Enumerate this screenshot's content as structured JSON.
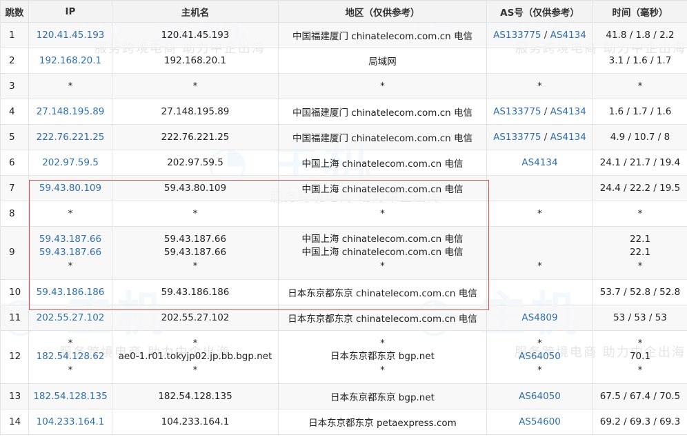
{
  "headers": [
    "跳数",
    "IP",
    "主机名",
    "地区（仅供参考）",
    "AS号（仅供参考）",
    "时间（毫秒）"
  ],
  "watermark": {
    "slogan": "服务跨境电商 助力中企出海"
  },
  "colors": {
    "link": "#2f6fad",
    "highlight_border": "#d9534f",
    "header_bg": "#f2f2f2",
    "border": "#e3e3e3"
  },
  "rows": [
    {
      "hop": "1",
      "ips": [
        "120.41.45.193"
      ],
      "hosts": [
        "120.41.45.193"
      ],
      "locs": [
        "中国福建厦门 chinatelecom.com.cn 电信"
      ],
      "as": [
        [
          "AS133775",
          "AS4134"
        ]
      ],
      "times": [
        "41.8 / 1.8 / 2.2"
      ]
    },
    {
      "hop": "2",
      "ips": [
        "192.168.20.1"
      ],
      "hosts": [
        "192.168.20.1"
      ],
      "locs": [
        "局域网"
      ],
      "as": [
        []
      ],
      "times": [
        "3.1 / 1.6 / 1.7"
      ]
    },
    {
      "hop": "3",
      "ips": [
        "*"
      ],
      "hosts": [
        "*"
      ],
      "locs": [
        "*"
      ],
      "as": [
        [
          "*"
        ]
      ],
      "times": [
        "*"
      ]
    },
    {
      "hop": "4",
      "ips": [
        "27.148.195.89"
      ],
      "hosts": [
        "27.148.195.89"
      ],
      "locs": [
        "中国福建厦门 chinatelecom.com.cn 电信"
      ],
      "as": [
        [
          "AS133775",
          "AS4134"
        ]
      ],
      "times": [
        "1.6 / 1.7 / 1.6"
      ]
    },
    {
      "hop": "5",
      "ips": [
        "222.76.221.25"
      ],
      "hosts": [
        "222.76.221.25"
      ],
      "locs": [
        "中国福建厦门 chinatelecom.com.cn 电信"
      ],
      "as": [
        [
          "AS133775",
          "AS4134"
        ]
      ],
      "times": [
        "4.9 / 10.7 / 8"
      ]
    },
    {
      "hop": "6",
      "ips": [
        "202.97.59.5"
      ],
      "hosts": [
        "202.97.59.5"
      ],
      "locs": [
        "中国上海 chinatelecom.com.cn 电信"
      ],
      "as": [
        [
          "AS4134"
        ]
      ],
      "times": [
        "24.1 / 21.7 / 19.4"
      ]
    },
    {
      "hop": "7",
      "ips": [
        "59.43.80.109"
      ],
      "hosts": [
        "59.43.80.109"
      ],
      "locs": [
        "中国上海 chinatelecom.com.cn 电信"
      ],
      "as": [
        []
      ],
      "times": [
        "24.4 / 22.2 / 19.5"
      ]
    },
    {
      "hop": "8",
      "ips": [
        "*"
      ],
      "hosts": [
        "*"
      ],
      "locs": [
        "*"
      ],
      "as": [
        [
          "*"
        ]
      ],
      "times": [
        "*"
      ]
    },
    {
      "hop": "9",
      "ips": [
        "59.43.187.66",
        "59.43.187.66",
        "*"
      ],
      "hosts": [
        "59.43.187.66",
        "59.43.187.66",
        "*"
      ],
      "locs": [
        "中国上海 chinatelecom.com.cn 电信",
        "中国上海 chinatelecom.com.cn 电信",
        "*"
      ],
      "as": [
        [],
        [],
        [
          "*"
        ]
      ],
      "times": [
        "22.1",
        "22.1",
        "*"
      ]
    },
    {
      "hop": "10",
      "ips": [
        "59.43.186.186"
      ],
      "hosts": [
        "59.43.186.186"
      ],
      "locs": [
        "日本东京都东京 chinatelecom.com.cn 电信"
      ],
      "as": [
        []
      ],
      "times": [
        "53.7 / 52.8 / 52.8"
      ]
    },
    {
      "hop": "11",
      "ips": [
        "202.55.27.102"
      ],
      "hosts": [
        "202.55.27.102"
      ],
      "locs": [
        "日本东京都东京 chinatelecom.com.cn 电信"
      ],
      "as": [
        [
          "AS4809"
        ]
      ],
      "times": [
        "53 / 53 / 53"
      ]
    },
    {
      "hop": "12",
      "ips": [
        "*",
        "182.54.128.62",
        "*"
      ],
      "hosts": [
        "*",
        "ae0-1.r01.tokyjp02.jp.bb.bgp.net",
        "*"
      ],
      "locs": [
        "*",
        "日本东京都东京 bgp.net",
        "*"
      ],
      "as": [
        [
          "*"
        ],
        [
          "AS64050"
        ],
        [
          "*"
        ]
      ],
      "times": [
        "*",
        "70.1",
        "*"
      ]
    },
    {
      "hop": "13",
      "ips": [
        "182.54.128.135"
      ],
      "hosts": [
        "182.54.128.135"
      ],
      "locs": [
        "日本东京都东京 bgp.net"
      ],
      "as": [
        [
          "AS64050"
        ]
      ],
      "times": [
        "67.5 / 67.4 / 70.5"
      ]
    },
    {
      "hop": "14",
      "ips": [
        "104.233.164.1"
      ],
      "hosts": [
        "104.233.164.1"
      ],
      "locs": [
        "日本东京都东京 petaexpress.com"
      ],
      "as": [
        [
          "AS54600"
        ]
      ],
      "times": [
        "69.2 / 69.3 / 69.3"
      ]
    }
  ]
}
